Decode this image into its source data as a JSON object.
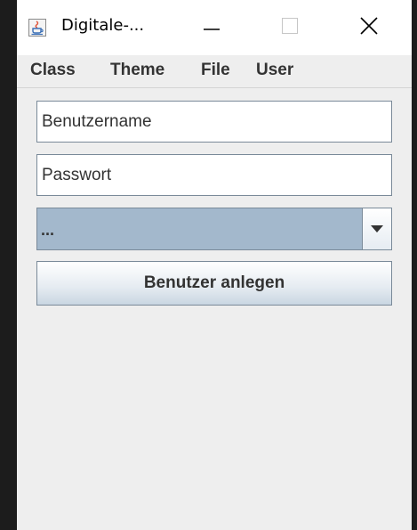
{
  "window": {
    "title": "Digitale-...",
    "icon": "java-cup-icon",
    "controls": {
      "minimize": "minimize-icon",
      "maximize": "maximize-icon",
      "close": "close-icon"
    }
  },
  "menu": {
    "items": [
      "Class",
      "Theme",
      "File",
      "User"
    ]
  },
  "form": {
    "username": {
      "value": "Benutzername",
      "placeholder": ""
    },
    "password": {
      "value": "Passwort",
      "placeholder": ""
    },
    "role_select": {
      "selected": "...",
      "arrow_icon": "chevron-down-icon"
    },
    "create_button_label": "Benutzer anlegen"
  },
  "colors": {
    "window_bg": "#eeeeee",
    "titlebar_bg": "#ffffff",
    "combo_bg": "#a3b8cc",
    "border": "#7a8a99",
    "text": "#333333",
    "outside_bg": "#1c1c1c",
    "accent_arrow": "#e0553b"
  }
}
